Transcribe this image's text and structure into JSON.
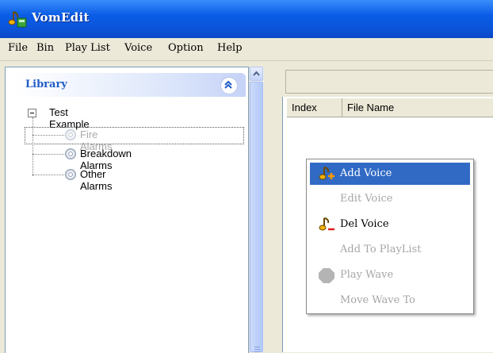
{
  "window": {
    "title": "VomEdit",
    "icon": "app-music-icon"
  },
  "menubar": {
    "items": [
      "File",
      "Bin",
      "Play List",
      "Voice",
      "Option",
      "Help"
    ]
  },
  "library": {
    "title": "Library",
    "collapse_icon": "chevron-double-up-icon",
    "tree": {
      "root": "Test Example",
      "children": [
        "Fire Alarms",
        "Breakdown Alarms",
        "Other Alarms"
      ],
      "selected": "Fire Alarms"
    }
  },
  "list": {
    "columns": [
      "Index",
      "File Name"
    ]
  },
  "context_menu": {
    "items": [
      {
        "label": "Add Voice",
        "icon": "add-voice-icon",
        "enabled": true,
        "highlighted": true
      },
      {
        "label": "Edit Voice",
        "icon": "",
        "enabled": false
      },
      {
        "label": "Del Voice",
        "icon": "delete-voice-icon",
        "enabled": true
      },
      {
        "label": "Add To PlayList",
        "icon": "",
        "enabled": false
      },
      {
        "label": "Play Wave",
        "icon": "stop-octagon-icon",
        "enabled": false
      },
      {
        "label": "Move Wave To",
        "icon": "",
        "enabled": false
      }
    ]
  },
  "colors": {
    "titlebar": "#0a5ce6",
    "highlight": "#316ac5",
    "library_title": "#215dc6"
  }
}
